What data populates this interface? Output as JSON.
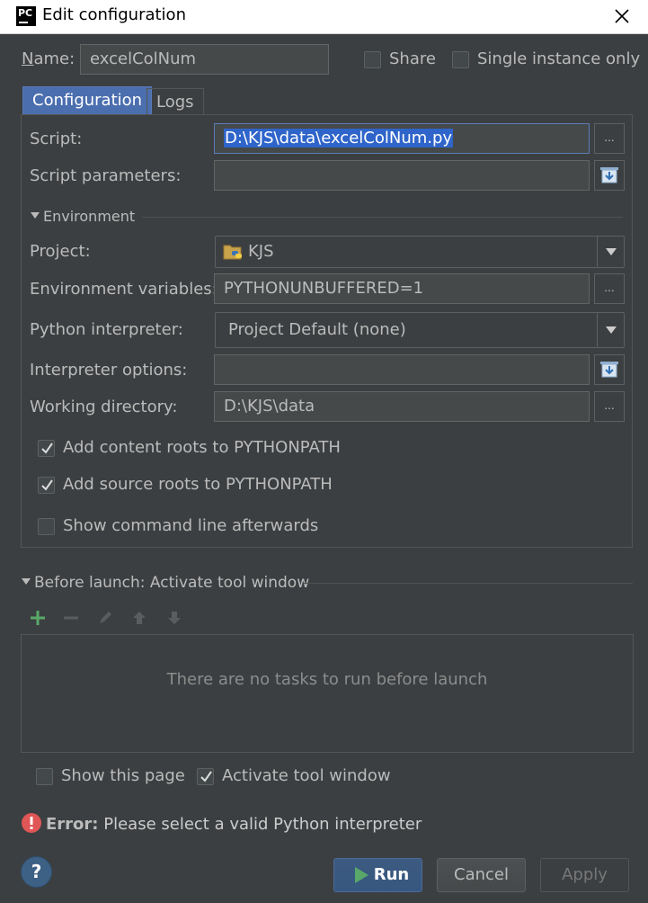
{
  "window": {
    "title": "Edit configuration",
    "app_icon_text": "PC"
  },
  "header": {
    "name_label": "Name:",
    "name_value": "excelColNum",
    "share_label": "Share",
    "single_instance_label": "Single instance only"
  },
  "tabs": [
    {
      "label": "Configuration",
      "active": true
    },
    {
      "label": "Logs",
      "active": false
    }
  ],
  "config": {
    "script_label": "Script:",
    "script_value": "D:\\KJS\\data\\excelColNum.py",
    "script_params_label": "Script parameters:",
    "script_params_value": "",
    "environment_section": "Environment",
    "project_label": "Project:",
    "project_value": "KJS",
    "env_vars_label": "Environment variables:",
    "env_vars_value": "PYTHONUNBUFFERED=1",
    "interpreter_label": "Python interpreter:",
    "interpreter_value": "Project Default (none)",
    "interp_options_label": "Interpreter options:",
    "interp_options_value": "",
    "workdir_label": "Working directory:",
    "workdir_value": "D:\\KJS\\data",
    "dots": "...",
    "add_content_roots_label": "Add content roots to PYTHONPATH",
    "add_content_roots_checked": true,
    "add_source_roots_label": "Add source roots to PYTHONPATH",
    "add_source_roots_checked": true,
    "show_cmdline_label": "Show command line afterwards",
    "show_cmdline_checked": false
  },
  "before_launch": {
    "section_label": "Before launch: Activate tool window",
    "empty_text": "There are no tasks to run before launch",
    "show_page_label": "Show this page",
    "show_page_checked": false,
    "activate_tool_label": "Activate tool window",
    "activate_tool_checked": true
  },
  "error": {
    "prefix": "Error:",
    "message": "Please select a valid Python interpreter"
  },
  "footer": {
    "run_label": "Run",
    "cancel_label": "Cancel",
    "apply_label": "Apply",
    "help_glyph": "?"
  },
  "colors": {
    "background": "#3c3f41",
    "accent": "#4b6eaf",
    "add_green": "#59a869",
    "error_red": "#e05555",
    "help_blue": "#3d6185"
  }
}
